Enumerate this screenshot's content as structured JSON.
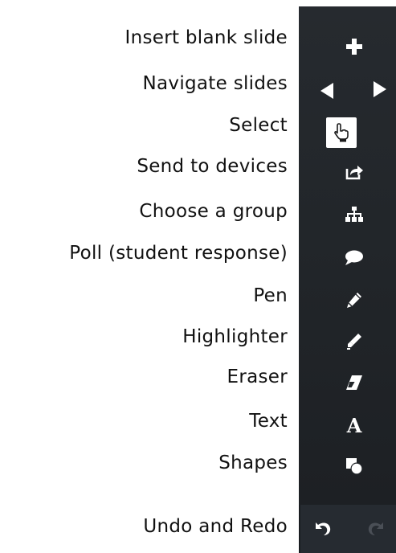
{
  "tools": [
    {
      "id": "insert",
      "label": "Insert blank slide",
      "icon": "plus-icon"
    },
    {
      "id": "navigate",
      "label": "Navigate slides",
      "icon": "arrow-left-right-icons"
    },
    {
      "id": "select",
      "label": "Select",
      "icon": "hand-pointer-icon"
    },
    {
      "id": "send",
      "label": "Send to devices",
      "icon": "share-icon"
    },
    {
      "id": "group",
      "label": "Choose a group",
      "icon": "sitemap-icon"
    },
    {
      "id": "poll",
      "label": "Poll (student response)",
      "icon": "speech-bubble-icon"
    },
    {
      "id": "pen",
      "label": "Pen",
      "icon": "pencil-icon"
    },
    {
      "id": "highlighter",
      "label": "Highlighter",
      "icon": "highlighter-icon"
    },
    {
      "id": "eraser",
      "label": "Eraser",
      "icon": "eraser-icon"
    },
    {
      "id": "text",
      "label": "Text",
      "icon": "text-a-icon"
    },
    {
      "id": "shapes",
      "label": "Shapes",
      "icon": "shapes-icon"
    },
    {
      "id": "undo",
      "label": "Undo and Redo",
      "icon": "undo-redo-icons"
    }
  ],
  "text_tool_glyph": "A",
  "colors": {
    "toolbar": "#22262a",
    "icon": "#ffffff",
    "redo_disabled": "#4a4f56",
    "label_text": "#111111"
  }
}
